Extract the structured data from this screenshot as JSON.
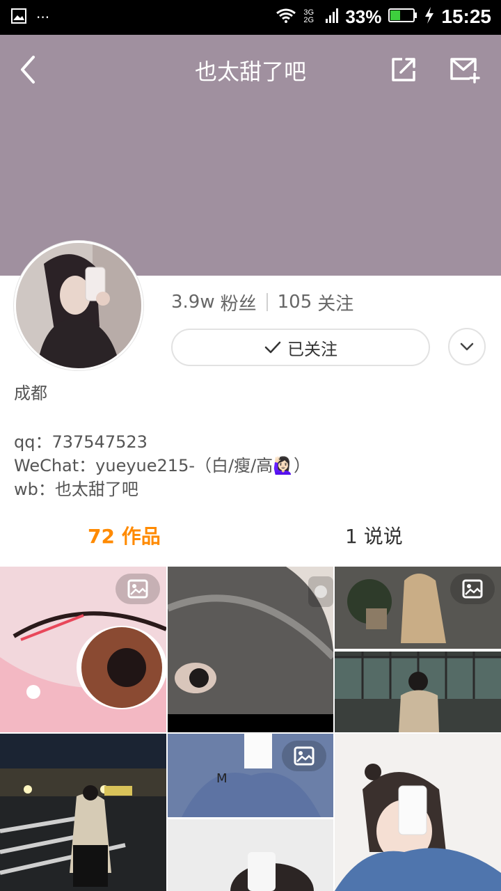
{
  "status_bar": {
    "signal": "3G 2G",
    "battery": "33%",
    "time": "15:25"
  },
  "header": {
    "title": "也太甜了吧",
    "back_icon": "chevron-left-icon",
    "share_icon": "share-icon",
    "message_icon": "mail-plus-icon"
  },
  "profile": {
    "followers_count": "3.9w",
    "followers_label": "粉丝",
    "following_count": "105",
    "following_label": "关注",
    "follow_button": "已关注",
    "location": "成都",
    "bio_lines": [
      "qq：737547523",
      "WeChat：yueyue215-（白/瘦/高🙋🏻‍♀️）",
      "wb：也太甜了吧"
    ]
  },
  "tabs": {
    "works": "72 作品",
    "posts": "1 说说"
  },
  "colors": {
    "accent": "#ff8a00",
    "cover": "#a0909f"
  }
}
